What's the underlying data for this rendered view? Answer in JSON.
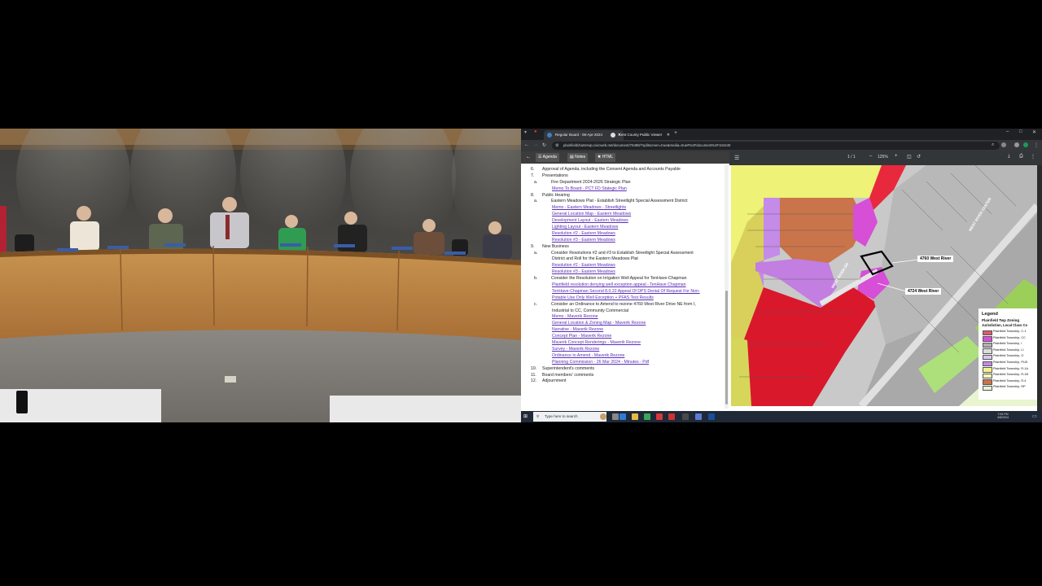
{
  "browser": {
    "tabs": [
      {
        "label": "Regular Board - 08-Apr-2024",
        "active": true
      },
      {
        "label": "Kent County Public Viewer",
        "active": false
      }
    ],
    "url": "plainfieldcharterwp.civicweb.net/document/76499/?splitscreen=true&media=true#%2Fdocument%2F104440"
  },
  "doc_toolbar": {
    "agenda": "Agenda",
    "notes": "Notes",
    "html": "HTML"
  },
  "agenda": [
    {
      "num": "6.",
      "text": "Approval of Agenda, including the Consent Agenda and Accounts Payable"
    },
    {
      "num": "7.",
      "text": "Presentations"
    },
    {
      "num": "a.",
      "text": "Fire Department 2024-2026 Strategic Plan",
      "indent": 1
    },
    {
      "text": "Memo To Board - PCT FD Stategic Plan",
      "indent": 2,
      "link": true
    },
    {
      "num": "8.",
      "text": "Public Hearing"
    },
    {
      "num": "a.",
      "text": "Eastern Meadows Plat - Establish Streetlight Special Assessment District",
      "indent": 1
    },
    {
      "text": "Memo - Eastern Meadows - Streetlights",
      "indent": 2,
      "link": true
    },
    {
      "text": "General Location Map - Eastern Meadows",
      "indent": 2,
      "link": true
    },
    {
      "text": "Development Layout - Eastern Meadows",
      "indent": 2,
      "link": true
    },
    {
      "text": "Lighting Layout - Eastern Meadows",
      "indent": 2,
      "link": true
    },
    {
      "text": "Resolution #2 - Eastern Meadows",
      "indent": 2,
      "link": true
    },
    {
      "text": "Resolution #3 - Eastern Meadows",
      "indent": 2,
      "link": true
    },
    {
      "num": "9.",
      "text": "New Business"
    },
    {
      "num": "a.",
      "text": "Consider Resolutions #2 and #3 to Establish Streetlight Special Assessment",
      "indent": 1
    },
    {
      "text": "District and Roll for the Eastern Meadows Plat",
      "indent": 2
    },
    {
      "text": "Resolution #2 - Eastern Meadows",
      "indent": 2,
      "link": true
    },
    {
      "text": "Resolution #3 - Eastern Meadows",
      "indent": 2,
      "link": true
    },
    {
      "num": "b.",
      "text": "Consider the Resolution on Irrigation Well Appeal for TenHave-Chapman",
      "indent": 1
    },
    {
      "text": "Plainfield resolution denying well exception appeal - TenHave Chapman",
      "indent": 2,
      "link": true
    },
    {
      "text": "TenHave-Chapman Second 8.0.22 Appeal Of DPS Denial Of Request For Non-",
      "indent": 2,
      "link": true
    },
    {
      "text": "Potable Use Only Well Exception + PFAS Test Results",
      "indent": 2,
      "link": true
    },
    {
      "num": "c.",
      "text": "Consider an Ordinance to Amend to rezone 4760 West River Drive NE from I,",
      "indent": 1
    },
    {
      "text": "Industrial to CC, Community Commercial",
      "indent": 2
    },
    {
      "text": "Memo - Maverik Rezone",
      "indent": 2,
      "link": true
    },
    {
      "text": "General Location & Zoning Map - Maverik Rezone",
      "indent": 2,
      "link": true
    },
    {
      "text": "Narrative - Maverik Rezone",
      "indent": 2,
      "link": true
    },
    {
      "text": "Concept Plan - Maverik Rezone",
      "indent": 2,
      "link": true
    },
    {
      "text": "Maverik Concept Renderings - Maverik Rezone",
      "indent": 2,
      "link": true
    },
    {
      "text": "Survey - Maverik Rezone",
      "indent": 2,
      "link": true
    },
    {
      "text": "Ordinance to Amend - Maverik Rezone",
      "indent": 2,
      "link": true
    },
    {
      "text": "Planning Commission - 26 Mar 2024 - Minutes - Pdf",
      "indent": 2,
      "link": true
    },
    {
      "num": "10.",
      "text": "Superintendent's comments"
    },
    {
      "num": "11.",
      "text": "Board members' comments"
    },
    {
      "num": "12.",
      "text": "Adjournment"
    }
  ],
  "pdf": {
    "page": "1 / 1",
    "zoom": "125%"
  },
  "map": {
    "labels": [
      "4760 West River",
      "4724 West River",
      "WEST RIVER DR",
      "WEST RIVER CENTER"
    ],
    "legend": {
      "title": "Legend",
      "subtitle": "Plainfield Twp Zoning",
      "subtitle2": "Jurisdiction, Local Class Co",
      "items": [
        {
          "label": "Plainfield Township, C-1",
          "color": "#e05a6a"
        },
        {
          "label": "Plainfield Township, CC",
          "color": "#d64fd6"
        },
        {
          "label": "Plainfield Township, I",
          "color": "#b0b0b0"
        },
        {
          "label": "Plainfield Township, LI",
          "color": "#dcdcdc"
        },
        {
          "label": "Plainfield Township, O",
          "color": "#d8c8f0"
        },
        {
          "label": "Plainfield Township, PUD",
          "color": "#c48be8"
        },
        {
          "label": "Plainfield Township, R-1A",
          "color": "#f4f48a"
        },
        {
          "label": "Plainfield Township, R-1B",
          "color": "#f6f6b8"
        },
        {
          "label": "Plainfield Township, R-4",
          "color": "#c9744a"
        },
        {
          "label": "Plainfield Township, RP",
          "color": "#e8f5d0"
        }
      ]
    }
  },
  "taskbar": {
    "search_placeholder": "Type here to search",
    "time": "7:05 PM",
    "date": "4/8/2024"
  }
}
